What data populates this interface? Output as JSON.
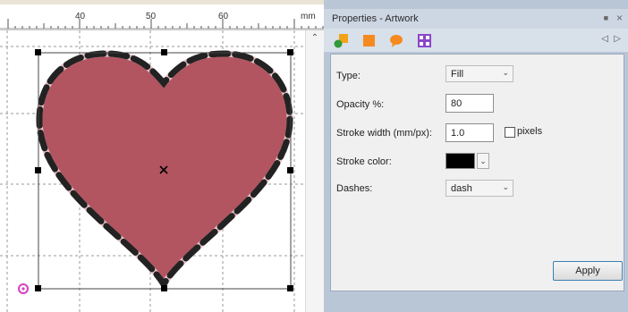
{
  "ruler": {
    "labels": [
      "40",
      "50",
      "60"
    ],
    "unit": "mm"
  },
  "canvas": {
    "shape_fill": "#b25561",
    "dash_color": "#222222",
    "selection_handle_color": "#000000",
    "rotate_handle_color": "#d63fc3"
  },
  "panel": {
    "title": "Properties - Artwork",
    "toolbar_icons": [
      "fill-color-icon",
      "orange-square-icon",
      "speech-bubble-icon",
      "pattern-icon"
    ],
    "fields": {
      "type_label": "Type:",
      "type_value": "Fill",
      "opacity_label": "Opacity %:",
      "opacity_value": "80",
      "stroke_width_label": "Stroke width (mm/px):",
      "stroke_width_value": "1.0",
      "pixels_label": "pixels",
      "stroke_color_label": "Stroke color:",
      "stroke_color_value": "#000000",
      "dashes_label": "Dashes:",
      "dashes_value": "dash"
    },
    "apply_label": "Apply"
  }
}
